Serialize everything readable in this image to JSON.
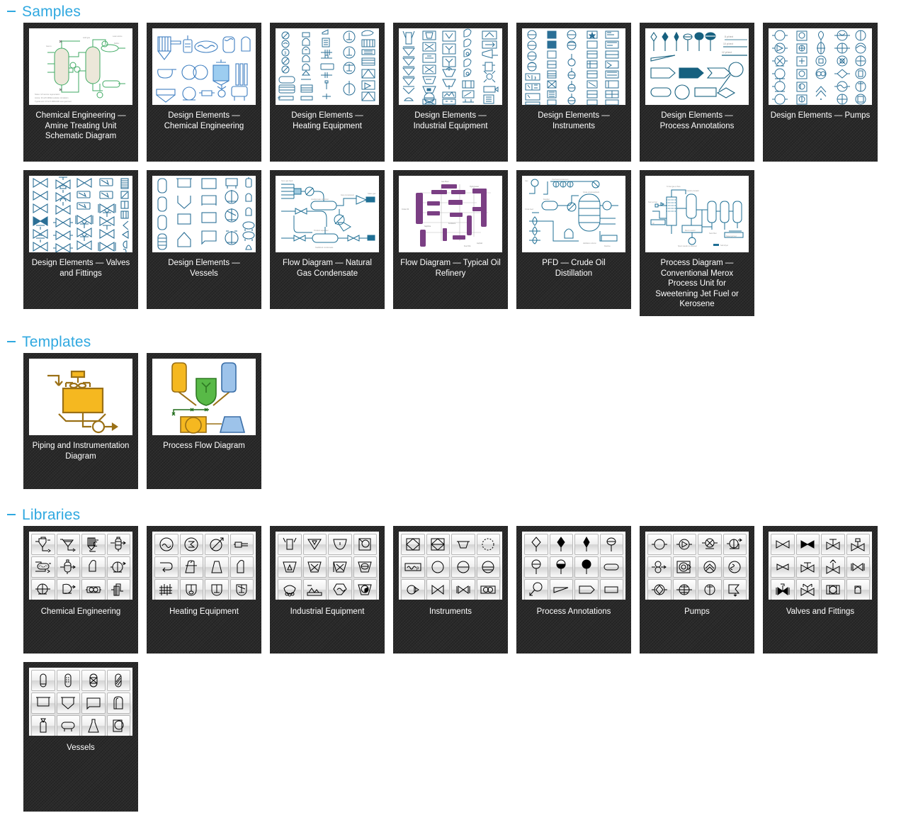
{
  "sections": [
    {
      "id": "samples",
      "title": "Samples",
      "collapse_icon": "minus-icon",
      "items": [
        {
          "label": "Chemical Engineering — Amine Treating Unit Schematic Diagram",
          "thumb": "amine-treating-unit"
        },
        {
          "label": "Design Elements — Chemical Engineering",
          "thumb": "chemical-engineering-elements"
        },
        {
          "label": "Design Elements — Heating Equipment",
          "thumb": "heating-equipment-elements"
        },
        {
          "label": "Design Elements — Industrial Equipment",
          "thumb": "industrial-equipment-elements"
        },
        {
          "label": "Design Elements — Instruments",
          "thumb": "instruments-elements"
        },
        {
          "label": "Design Elements — Process Annotations",
          "thumb": "process-annotations-elements"
        },
        {
          "label": "Design Elements — Pumps",
          "thumb": "pumps-elements"
        },
        {
          "label": "Design Elements — Valves and Fittings",
          "thumb": "valves-fittings-elements"
        },
        {
          "label": "Design Elements — Vessels",
          "thumb": "vessels-elements"
        },
        {
          "label": "Flow Diagram — Natural Gas Condensate",
          "thumb": "natural-gas-condensate"
        },
        {
          "label": "Flow Diagram — Typical Oil Refinery",
          "thumb": "typical-oil-refinery"
        },
        {
          "label": "PFD — Crude Oil Distillation",
          "thumb": "crude-oil-distillation"
        },
        {
          "label": "Process Diagram — Conventional Merox Process Unit for Sweetening Jet Fuel or Kerosene",
          "thumb": "merox-process-unit"
        }
      ]
    },
    {
      "id": "templates",
      "title": "Templates",
      "collapse_icon": "minus-icon",
      "items": [
        {
          "label": "Piping and Instrumentation Diagram",
          "thumb": "piping-instrumentation-template"
        },
        {
          "label": "Process Flow Diagram",
          "thumb": "process-flow-template"
        }
      ]
    },
    {
      "id": "libraries",
      "title": "Libraries",
      "collapse_icon": "minus-icon",
      "items": [
        {
          "label": "Chemical Engineering",
          "thumb": "chemical-engineering-library"
        },
        {
          "label": "Heating Equipment",
          "thumb": "heating-equipment-library"
        },
        {
          "label": "Industrial Equipment",
          "thumb": "industrial-equipment-library"
        },
        {
          "label": "Instruments",
          "thumb": "instruments-library"
        },
        {
          "label": "Process Annotations",
          "thumb": "process-annotations-library"
        },
        {
          "label": "Pumps",
          "thumb": "pumps-library"
        },
        {
          "label": "Valves and Fittings",
          "thumb": "valves-fittings-library"
        },
        {
          "label": "Vessels",
          "thumb": "vessels-library"
        }
      ]
    }
  ],
  "colors": {
    "accent": "#2FA8E0",
    "card_background": "#2b2b2b",
    "caption_text": "#ffffff",
    "diagram_blue": "#1f6f94",
    "diagram_green": "#3faa63",
    "diagram_purple": "#7b3f84",
    "template_yellow": "#f5b820",
    "template_blue": "#9dc3ea",
    "template_green": "#58b947",
    "template_line": "#9a7016",
    "page_background": "#ffffff"
  },
  "annotation_labels": {
    "process_annotations_8pt": "8 pt text",
    "process_annotations_10pt": "10 pt text",
    "process_annotations_12pt": "12 pt text"
  }
}
